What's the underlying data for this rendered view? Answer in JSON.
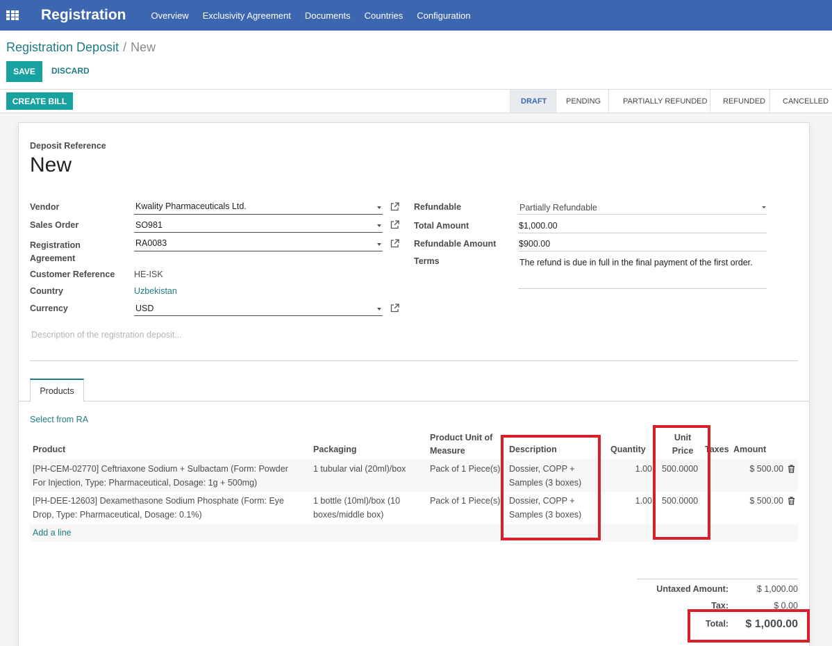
{
  "navbar": {
    "brand": "Registration",
    "menu": [
      "Overview",
      "Exclusivity Agreement",
      "Documents",
      "Countries",
      "Configuration"
    ]
  },
  "breadcrumb": {
    "parent": "Registration Deposit",
    "separator": "/",
    "current": "New"
  },
  "buttons": {
    "save": "SAVE",
    "discard": "DISCARD",
    "create_bill": "CREATE BILL"
  },
  "stages": [
    {
      "label": "DRAFT",
      "active": true
    },
    {
      "label": "PENDING",
      "active": false
    },
    {
      "label": "PARTIALLY REFUNDED",
      "active": false
    },
    {
      "label": "REFUNDED",
      "active": false
    },
    {
      "label": "CANCELLED",
      "active": false
    }
  ],
  "form": {
    "ref_label": "Deposit Reference",
    "ref_value": "New",
    "vendor_label": "Vendor",
    "vendor": "Kwality Pharmaceuticals Ltd.",
    "sales_order_label": "Sales Order",
    "sales_order": "SO981",
    "agreement_label_1": "Registration",
    "agreement_label_2": "Agreement",
    "agreement": "RA0083",
    "customer_ref_label": "Customer Reference",
    "customer_ref": "HE-ISK",
    "country_label": "Country",
    "country": "Uzbekistan",
    "currency_label": "Currency",
    "currency": "USD",
    "refundable_label": "Refundable",
    "refundable": "Partially Refundable",
    "total_amount_label": "Total Amount",
    "total_amount": "$1,000.00",
    "refundable_amount_label": "Refundable Amount",
    "refundable_amount": "$900.00",
    "terms_label": "Terms",
    "terms": "The refund is due in full in the final payment of the first order.",
    "description_placeholder": "Description of the registration deposit..."
  },
  "tabs": {
    "products": "Products"
  },
  "lines": {
    "select_from_ra": "Select from RA",
    "headers": {
      "product": "Product",
      "packaging": "Packaging",
      "uom_1": "Product Unit of",
      "uom_2": "Measure",
      "description": "Description",
      "quantity": "Quantity",
      "unit_price_1": "Unit",
      "unit_price_2": "Price",
      "taxes": "Taxes",
      "amount": "Amount"
    },
    "rows": [
      {
        "product_1": "[PH-CEM-02770] Ceftriaxone Sodium + Sulbactam (Form: Powder",
        "product_2": "For Injection, Type: Pharmaceutical, Dosage: 1g + 500mg)",
        "packaging_1": "1 tubular vial (20ml)/box",
        "packaging_2": "",
        "uom": "Pack of 1 Piece(s)",
        "description_1": "Dossier, COPP +",
        "description_2": "Samples (3 boxes)",
        "quantity": "1.00",
        "unit_price": "500.0000",
        "amount": "$ 500.00"
      },
      {
        "product_1": "[PH-DEE-12603] Dexamethasone Sodium Phosphate (Form: Eye",
        "product_2": "Drop, Type: Pharmaceutical, Dosage: 0.1%)",
        "packaging_1": "1 bottle (10ml)/box (10",
        "packaging_2": "boxes/middle box)",
        "uom": "Pack of 1 Piece(s)",
        "description_1": "Dossier, COPP +",
        "description_2": "Samples (3 boxes)",
        "quantity": "1.00",
        "unit_price": "500.0000",
        "amount": "$ 500.00"
      }
    ],
    "add_line": "Add a line"
  },
  "totals": {
    "untaxed_label": "Untaxed Amount:",
    "untaxed": "$ 1,000.00",
    "tax_label": "Tax:",
    "tax": "$ 0.00",
    "total_label": "Total:",
    "total": "$ 1,000.00"
  },
  "colors": {
    "navbar": "#3d66b0",
    "primary_button": "#17a2a0",
    "link": "#1f7c82",
    "highlight": "#d9202a"
  }
}
